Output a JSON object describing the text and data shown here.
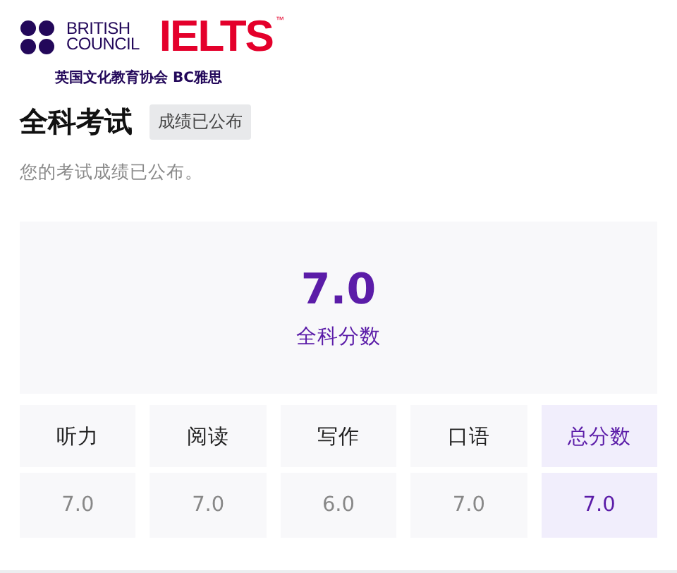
{
  "logo": {
    "brand_lines": [
      "BRITISH",
      "COUNCIL"
    ],
    "product": "IELTS",
    "trademark": "™",
    "subtitle": "英国文化教育协会 BC雅思"
  },
  "header": {
    "title": "全科考试",
    "badge": "成绩已公布",
    "description": "您的考试成绩已公布。"
  },
  "overall": {
    "score": "7.0",
    "label": "全科分数"
  },
  "scores": [
    {
      "label": "听力",
      "value": "7.0",
      "highlighted": false
    },
    {
      "label": "阅读",
      "value": "7.0",
      "highlighted": false
    },
    {
      "label": "写作",
      "value": "6.0",
      "highlighted": false
    },
    {
      "label": "口语",
      "value": "7.0",
      "highlighted": false
    },
    {
      "label": "总分数",
      "value": "7.0",
      "highlighted": true
    }
  ]
}
